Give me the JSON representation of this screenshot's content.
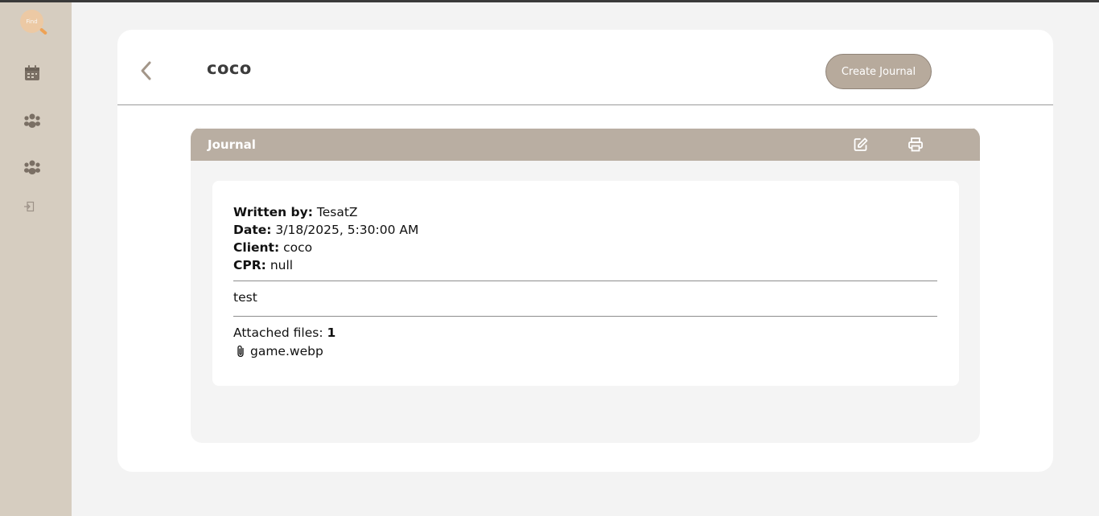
{
  "sidebar": {
    "logo_text": "Find",
    "items": [
      {
        "icon": "calendar-icon"
      },
      {
        "icon": "group-icon"
      },
      {
        "icon": "group-icon"
      },
      {
        "icon": "logout-icon"
      }
    ]
  },
  "header": {
    "title": "coco",
    "create_button": "Create Journal"
  },
  "journal": {
    "panel_title": "Journal",
    "written_by_label": "Written by:",
    "written_by": "TesatZ",
    "date_label": "Date:",
    "date": "3/18/2025, 5:30:00 AM",
    "client_label": "Client:",
    "client": "coco",
    "cpr_label": "CPR:",
    "cpr": "null",
    "body": "test",
    "attached_label": "Attached files:",
    "attached_count": "1",
    "files": [
      "game.webp"
    ]
  },
  "colors": {
    "sidebar_bg": "#d6cdc0",
    "accent": "#b9aea2",
    "button_bg": "#b7aa9c",
    "logo": "#eea255"
  }
}
